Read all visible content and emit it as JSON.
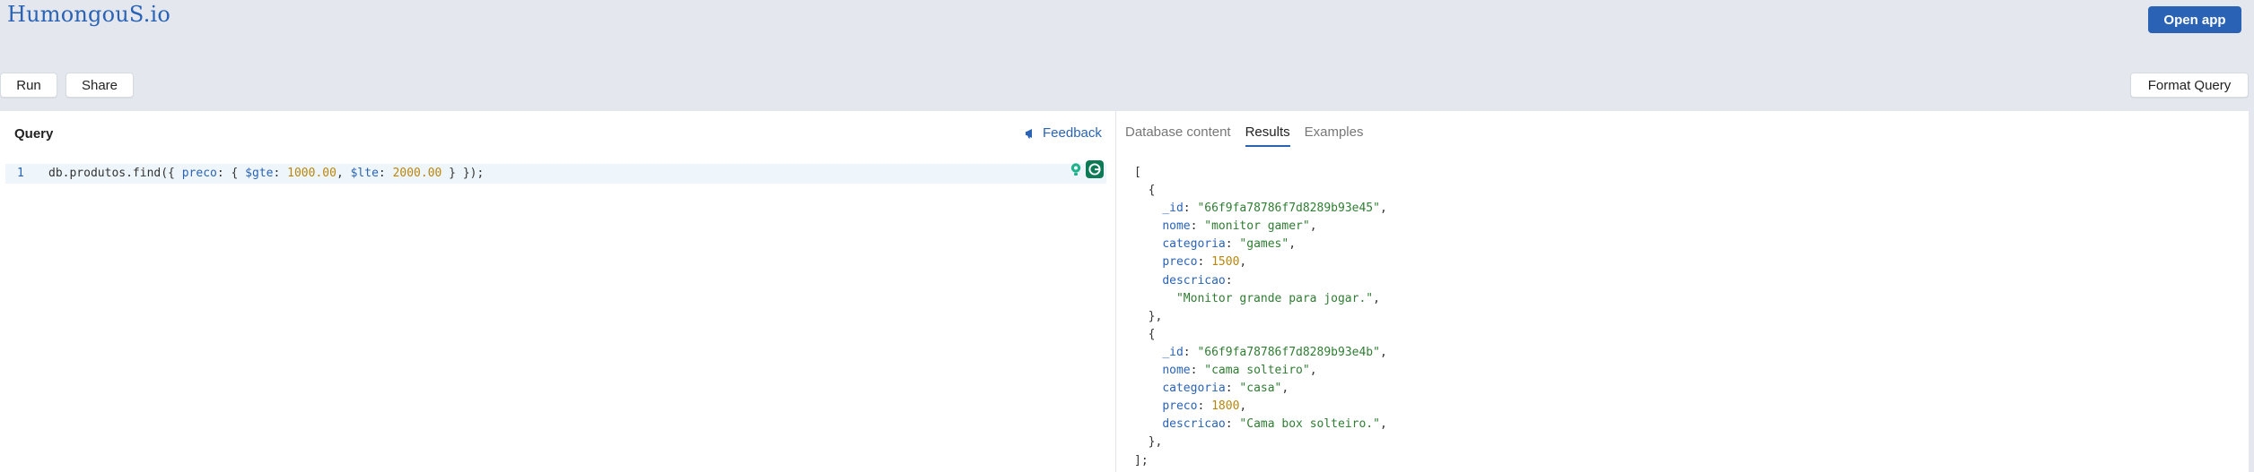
{
  "app": {
    "logo": "HumongouS.io",
    "open_app_label": "Open app"
  },
  "toolbar": {
    "run_label": "Run",
    "share_label": "Share",
    "format_label": "Format Query"
  },
  "query": {
    "title": "Query",
    "feedback_label": "Feedback",
    "line_number": "1",
    "code_tokens": [
      {
        "t": "db.produtos.find({ ",
        "c": "plain"
      },
      {
        "t": "preco",
        "c": "prop"
      },
      {
        "t": ": { ",
        "c": "plain"
      },
      {
        "t": "$gte",
        "c": "prop"
      },
      {
        "t": ": ",
        "c": "plain"
      },
      {
        "t": "1000.00",
        "c": "num"
      },
      {
        "t": ", ",
        "c": "plain"
      },
      {
        "t": "$lte",
        "c": "prop"
      },
      {
        "t": ": ",
        "c": "plain"
      },
      {
        "t": "2000.00",
        "c": "num"
      },
      {
        "t": " } });",
        "c": "plain"
      }
    ]
  },
  "tabs": [
    {
      "label": "Database content",
      "active": false
    },
    {
      "label": "Results",
      "active": true
    },
    {
      "label": "Examples",
      "active": false
    }
  ],
  "results": [
    {
      "_id": "\"66f9fa78786f7d8289b93e45\"",
      "nome": "\"monitor gamer\"",
      "categoria": "\"games\"",
      "preco": "1500",
      "descricao": "\"Monitor grande para jogar.\""
    },
    {
      "_id": "\"66f9fa78786f7d8289b93e4b\"",
      "nome": "\"cama solteiro\"",
      "categoria": "\"casa\"",
      "preco": "1800",
      "descricao": "\"Cama box solteiro.\""
    }
  ],
  "colors": {
    "accent": "#2a63b6",
    "string": "#2f7d32",
    "number": "#b8860b",
    "background": "#e4e8ee"
  }
}
